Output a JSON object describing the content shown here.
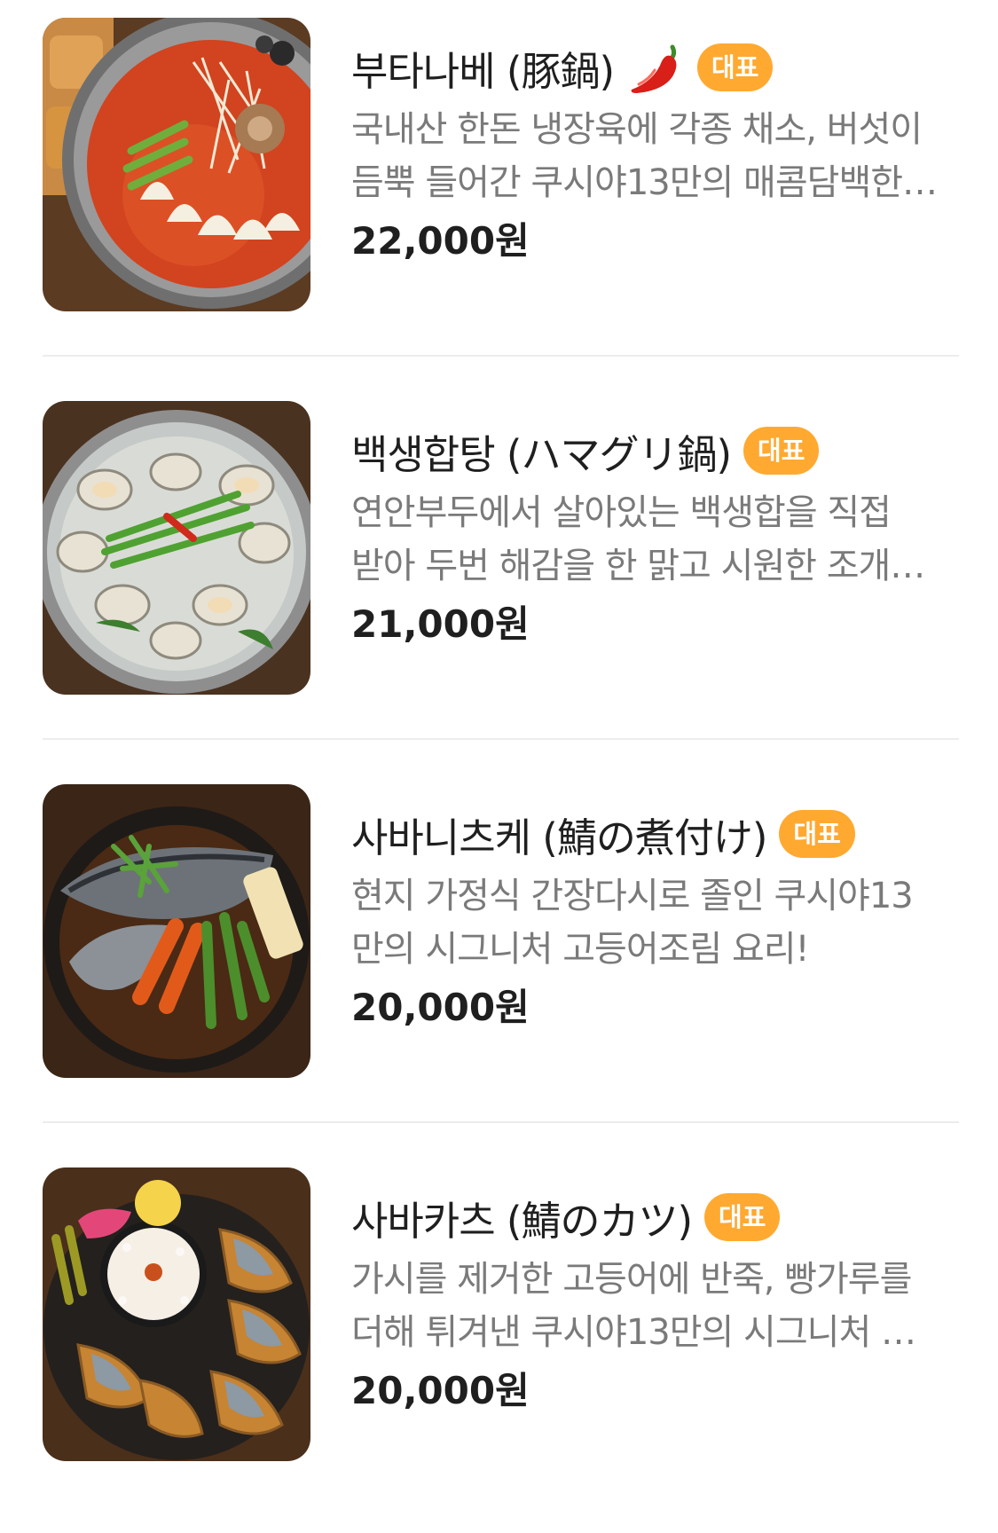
{
  "menu_items": [
    {
      "name": "부타나베 (豚鍋)",
      "has_spicy_icon": true,
      "badge": "대표",
      "desc_line1": "국내산 한돈 냉장육에 각종 채소, 버섯이",
      "desc_line2": "듬뿍 들어간 쿠시야13만의 매콤담백한…",
      "price": "22,000원"
    },
    {
      "name": "백생합탕 (ハマグリ鍋)",
      "has_spicy_icon": false,
      "badge": "대표",
      "desc_line1": "연안부두에서 살아있는 백생합을 직접",
      "desc_line2": "받아 두번 해감을 한 맑고 시원한 조개…",
      "price": "21,000원"
    },
    {
      "name": "사바니츠케 (鯖の煮付け)",
      "has_spicy_icon": false,
      "badge": "대표",
      "desc_line1": "현지 가정식 간장다시로 졸인 쿠시야13",
      "desc_line2": "만의 시그니처 고등어조림 요리!",
      "price": "20,000원"
    },
    {
      "name": "사바카츠 (鯖のカツ)",
      "has_spicy_icon": false,
      "badge": "대표",
      "desc_line1": "가시를 제거한 고등어에 반죽, 빵가루를",
      "desc_line2": "더해 튀겨낸 쿠시야13만의 시그니처 …",
      "price": "20,000원"
    }
  ],
  "colors": {
    "badge_bg": "#ffa931",
    "title_text": "#1f1f1f",
    "desc_text": "#7a7a7a",
    "divider": "#ececec"
  },
  "icons": [
    "chili-pepper-icon"
  ]
}
